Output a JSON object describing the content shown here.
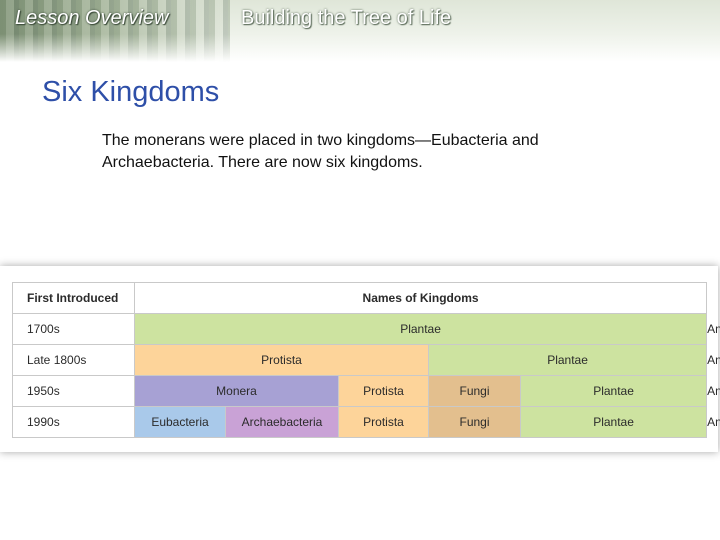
{
  "header": {
    "lesson_label": "Lesson Overview",
    "lesson_title": "Building the Tree of Life"
  },
  "slide": {
    "title": "Six Kingdoms",
    "body": "The monerans were placed in two kingdoms—Eubacteria and Archaebacteria. There are now six kingdoms."
  },
  "table": {
    "headers": {
      "first_introduced": "First Introduced",
      "names": "Names of Kingdoms"
    },
    "rows": [
      {
        "year": "1700s",
        "cells": [
          {
            "label": "Plantae",
            "span": 7
          },
          {
            "label": "Animalia",
            "span": 1
          }
        ]
      },
      {
        "year": "Late 1800s",
        "cells": [
          {
            "label": "Protista",
            "span": 4
          },
          {
            "label": "Plantae",
            "span": 3
          },
          {
            "label": "Animalia",
            "span": 1
          }
        ]
      },
      {
        "year": "1950s",
        "cells": [
          {
            "label": "Monera",
            "span": 2
          },
          {
            "label": "Protista",
            "span": 2
          },
          {
            "label": "Fungi",
            "span": 1
          },
          {
            "label": "Plantae",
            "span": 2
          },
          {
            "label": "Animalia",
            "span": 1
          }
        ]
      },
      {
        "year": "1990s",
        "cells": [
          {
            "label": "Eubacteria",
            "span": 1
          },
          {
            "label": "Archaebacteria",
            "span": 1
          },
          {
            "label": "Protista",
            "span": 2
          },
          {
            "label": "Fungi",
            "span": 1
          },
          {
            "label": "Plantae",
            "span": 2
          },
          {
            "label": "Animalia",
            "span": 1
          }
        ]
      }
    ]
  },
  "colors": {
    "title": "#2e4fa8",
    "Plantae": "#cde3a0",
    "Animalia": "#f4a98c",
    "Protista": "#fdd49a",
    "Monera": "#a7a1d4",
    "Fungi": "#e3bf8e",
    "Eubacteria": "#a9c9ea",
    "Archaebacteria": "#c9a2d6"
  }
}
